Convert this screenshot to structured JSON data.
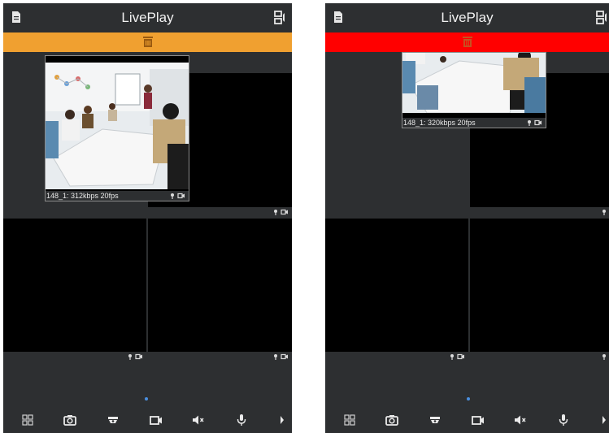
{
  "app": {
    "title": "LivePlay"
  },
  "colors": {
    "delete_bar_idle": "#f0a030",
    "delete_bar_active": "#ff0000",
    "background": "#2d2f31",
    "video_cell": "#000000",
    "page_dot": "#4a8fe0"
  },
  "left_screen": {
    "delete_bar_state": "idle",
    "floating_preview_label": "148_1: 312kbps 20fps"
  },
  "right_screen": {
    "delete_bar_state": "active",
    "floating_preview_label": "148_1: 320kbps 20fps"
  },
  "toolbar": {
    "icons": [
      "grid-layout-icon",
      "snapshot-icon",
      "ptz-icon",
      "record-icon",
      "mute-icon",
      "talk-icon",
      "more-arrow-icon"
    ]
  }
}
